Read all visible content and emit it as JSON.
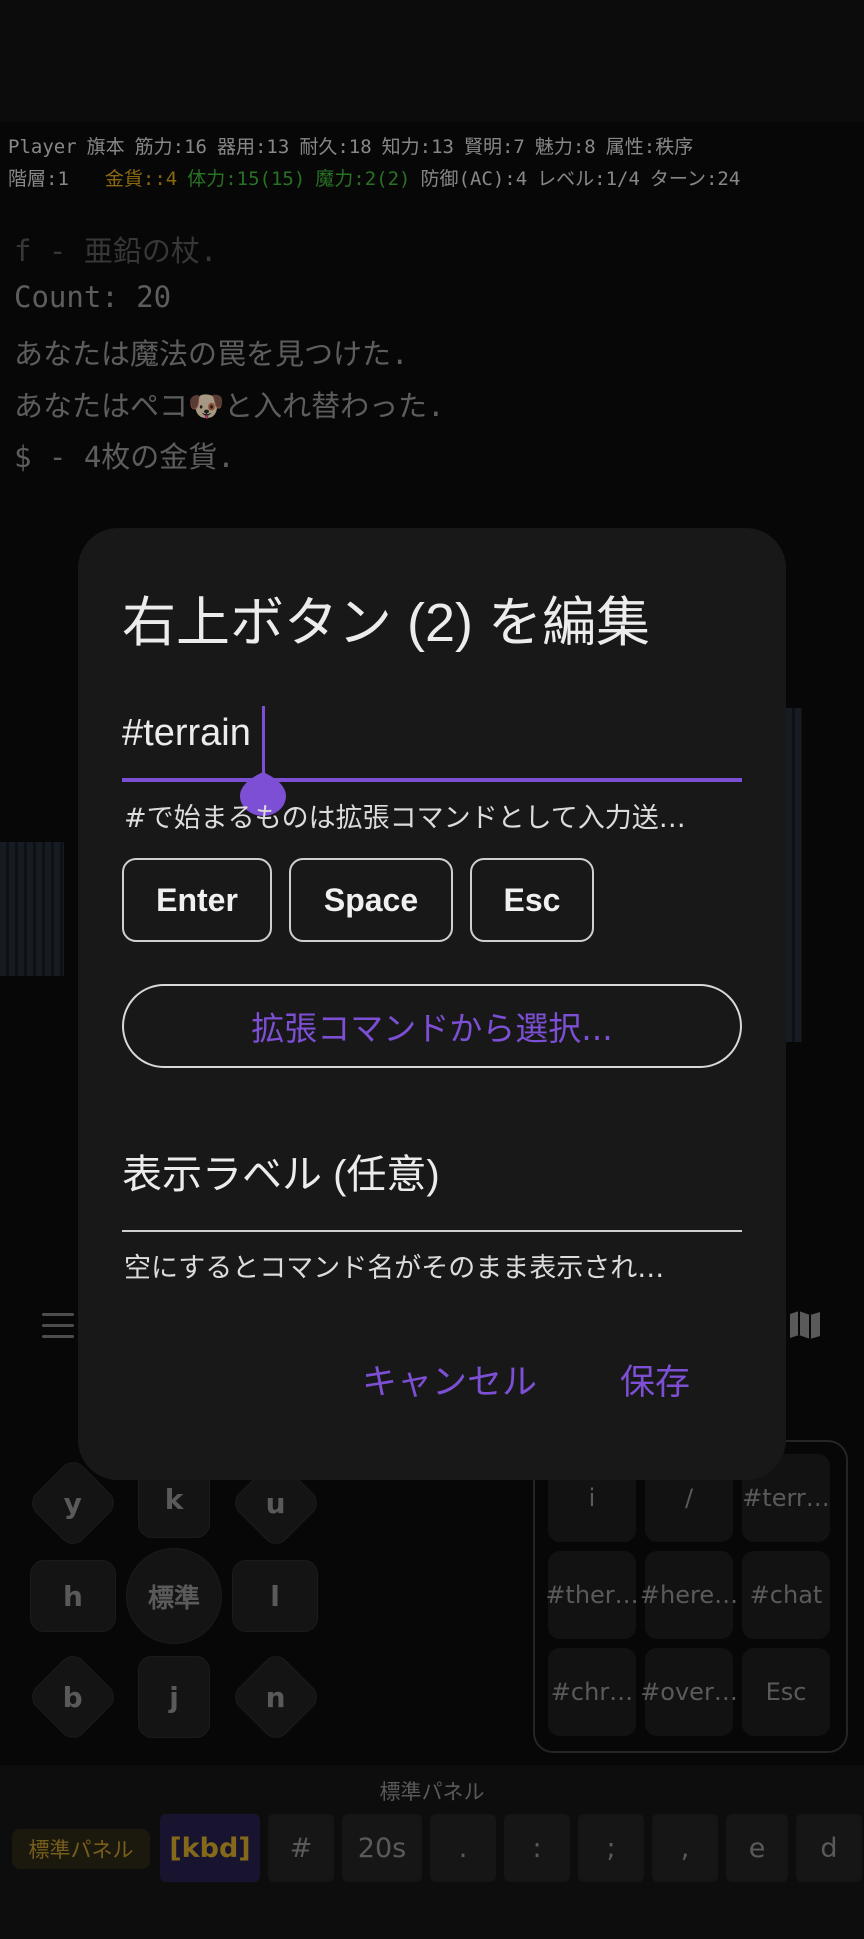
{
  "status": {
    "line1": [
      "Player",
      "旗本",
      "筋力:16",
      "器用:13",
      "耐久:18",
      "知力:13",
      "賢明:7",
      "魅力:8",
      "属性:秩序"
    ],
    "line2": {
      "floor": "階層:1",
      "gold": "金貨::4",
      "hp": "体力:15(15)",
      "mp": "魔力:2(2)",
      "ac": "防御(AC):4",
      "level": "レベル:1/4",
      "turn": "ターン:24"
    }
  },
  "messages": [
    "f - 亜鉛の杖.",
    "Count: 20",
    "あなたは魔法の罠を見つけた.",
    "あなたはペコ🐶と入れ替わった.",
    "$ - 4枚の金貨."
  ],
  "dpad": {
    "y": "y",
    "k": "k",
    "u": "u",
    "h": "h",
    "center": "標準",
    "l": "l",
    "b": "b",
    "j": "j",
    "n": "n"
  },
  "quick_buttons": [
    "i",
    "/",
    "#terr…",
    "#ther…",
    "#here…",
    "#chat",
    "#chr…",
    "#over…",
    "Esc"
  ],
  "bottom": {
    "panel_title": "標準パネル",
    "keys": [
      "標準パネル",
      "[kbd]",
      "#",
      "20s",
      ".",
      ":",
      ";",
      ",",
      "e",
      "d"
    ]
  },
  "dialog": {
    "title": "右上ボタン (2) を編集",
    "command_value": "#terrain",
    "command_helper": "#で始まるものは拡張コマンドとして入力送…",
    "key_chips": [
      "Enter",
      "Space",
      "Esc"
    ],
    "ext_button": "拡張コマンドから選択...",
    "label_placeholder": "表示ラベル (任意)",
    "label_helper": "空にするとコマンド名がそのまま表示され…",
    "cancel": "キャンセル",
    "save": "保存"
  },
  "colors": {
    "accent": "#7c4fd4",
    "gold": "#d4a017",
    "hp": "#3fae3a"
  }
}
